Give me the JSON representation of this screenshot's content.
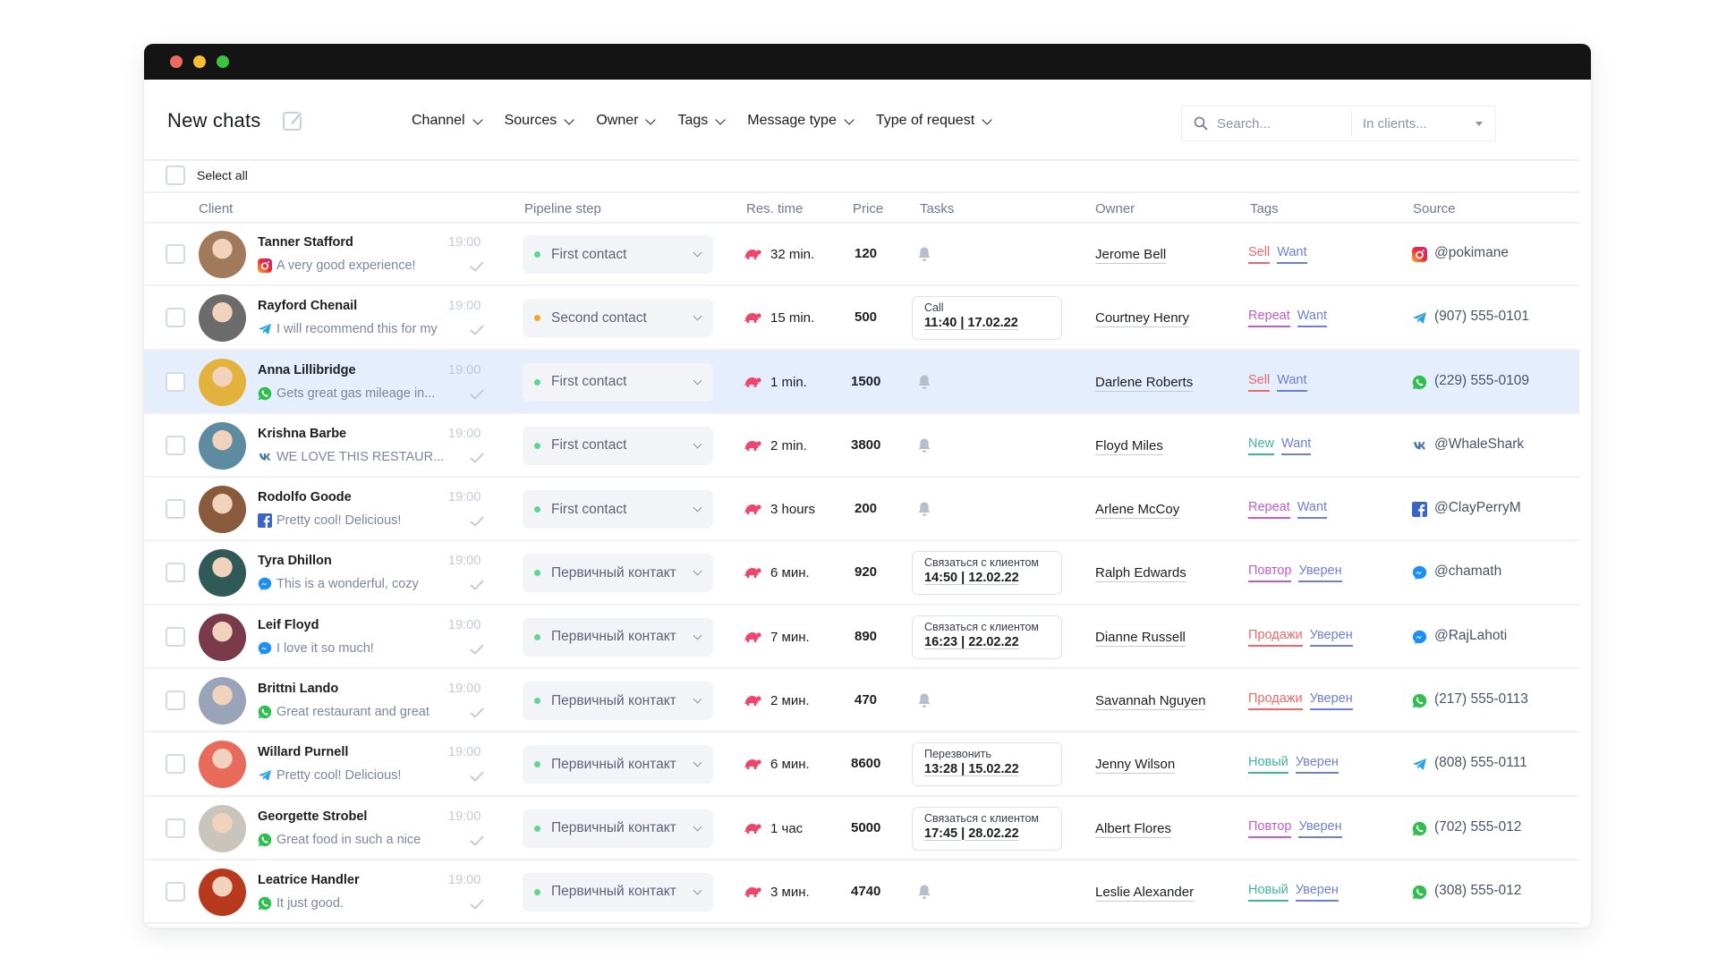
{
  "window": {
    "title_bar_buttons": [
      "close",
      "minimize",
      "maximize"
    ]
  },
  "header": {
    "title": "New chats",
    "edit_icon": "edit-icon",
    "filters": [
      {
        "label": "Channel"
      },
      {
        "label": "Sources"
      },
      {
        "label": "Owner"
      },
      {
        "label": "Tags"
      },
      {
        "label": "Message type"
      },
      {
        "label": "Type of request"
      }
    ],
    "search": {
      "placeholder": "Search...",
      "value": ""
    },
    "scope": {
      "placeholder": "In clients..."
    }
  },
  "select_all_label": "Select all",
  "columns": {
    "client": "Client",
    "pipeline": "Pipeline step",
    "res_time": "Res. time",
    "price": "Price",
    "tasks": "Tasks",
    "owner": "Owner",
    "tags": "Tags",
    "source": "Source"
  },
  "colors": {
    "accent_selected_row": "#e5eefc",
    "status_green": "#5dd68e",
    "status_orange": "#f5a623",
    "tag_red": "#e8696b",
    "tag_purple": "#c05ccb",
    "tag_blue": "#6f7fd4",
    "tag_teal": "#3fb59c",
    "turtle": "#f0456a"
  },
  "rows": [
    {
      "name": "Tanner Stafford",
      "time": "19:00",
      "channel": "instagram",
      "message": "A very good experience!",
      "pipeline": "First contact",
      "pipeline_status": "green",
      "res_time": "32 min.",
      "price": "120",
      "task": null,
      "owner": "Jerome Bell",
      "tags": [
        {
          "label": "Sell",
          "color": "red"
        },
        {
          "label": "Want",
          "color": "blue"
        }
      ],
      "source_channel": "instagram",
      "source": "@pokimane",
      "selected": false,
      "avatar_color": "#a07a5a"
    },
    {
      "name": "Rayford Chenail",
      "time": "19:00",
      "channel": "telegram",
      "message": "I will recommend this for my",
      "pipeline": "Second contact",
      "pipeline_status": "orange",
      "res_time": "15 min.",
      "price": "500",
      "task": {
        "title": "Call",
        "when": "11:40 | 17.02.22"
      },
      "owner": "Courtney Henry",
      "tags": [
        {
          "label": "Repeat",
          "color": "purple"
        },
        {
          "label": "Want",
          "color": "blue"
        }
      ],
      "source_channel": "telegram",
      "source": "(907) 555-0101",
      "selected": false,
      "avatar_color": "#6b6b6b"
    },
    {
      "name": "Anna Lillibridge",
      "time": "19:00",
      "channel": "whatsapp",
      "message": "Gets great gas mileage in...",
      "pipeline": "First contact",
      "pipeline_status": "green",
      "res_time": "1 min.",
      "price": "1500",
      "task": null,
      "owner": "Darlene Roberts",
      "tags": [
        {
          "label": "Sell",
          "color": "red"
        },
        {
          "label": "Want",
          "color": "blue"
        }
      ],
      "source_channel": "whatsapp",
      "source": "(229) 555-0109",
      "selected": true,
      "avatar_color": "#e3b23c"
    },
    {
      "name": "Krishna Barbe",
      "time": "19:00",
      "channel": "vk",
      "message": "WE LOVE THIS RESTAUR...",
      "pipeline": "First contact",
      "pipeline_status": "green",
      "res_time": "2 min.",
      "price": "3800",
      "task": null,
      "owner": "Floyd Miles",
      "tags": [
        {
          "label": "New",
          "color": "teal"
        },
        {
          "label": "Want",
          "color": "blue"
        }
      ],
      "source_channel": "vk",
      "source": "@WhaleShark",
      "selected": false,
      "avatar_color": "#5d8ca0"
    },
    {
      "name": "Rodolfo Goode",
      "time": "19:00",
      "channel": "facebook",
      "message": "Pretty cool! Delicious!",
      "pipeline": "First contact",
      "pipeline_status": "green",
      "res_time": "3 hours",
      "price": "200",
      "task": null,
      "owner": "Arlene McCoy",
      "tags": [
        {
          "label": "Repeat",
          "color": "purple"
        },
        {
          "label": "Want",
          "color": "blue"
        }
      ],
      "source_channel": "facebook",
      "source": "@ClayPerryM",
      "selected": false,
      "avatar_color": "#8a5a3c"
    },
    {
      "name": "Tyra Dhillon",
      "time": "19:00",
      "channel": "messenger",
      "message": "This is a wonderful, cozy",
      "pipeline": "Первичный контакт",
      "pipeline_status": "green",
      "res_time": "6 мин.",
      "price": "920",
      "task": {
        "title": "Связаться с клиентом",
        "when": "14:50 | 12.02.22"
      },
      "owner": "Ralph Edwards",
      "tags": [
        {
          "label": "Повтор",
          "color": "purple"
        },
        {
          "label": "Уверен",
          "color": "blue"
        }
      ],
      "source_channel": "messenger",
      "source": "@chamath",
      "selected": false,
      "avatar_color": "#2f5a58"
    },
    {
      "name": "Leif Floyd",
      "time": "19:00",
      "channel": "messenger",
      "message": "I love it so much!",
      "pipeline": "Первичный контакт",
      "pipeline_status": "green",
      "res_time": "7 мин.",
      "price": "890",
      "task": {
        "title": "Связаться с клиентом",
        "when": "16:23 | 22.02.22"
      },
      "owner": "Dianne Russell",
      "tags": [
        {
          "label": "Продажи",
          "color": "red"
        },
        {
          "label": "Уверен",
          "color": "blue"
        }
      ],
      "source_channel": "messenger",
      "source": "@RajLahoti",
      "selected": false,
      "avatar_color": "#7a3a4a"
    },
    {
      "name": "Brittni Lando",
      "time": "19:00",
      "channel": "whatsapp",
      "message": "Great restaurant and great",
      "pipeline": "Первичный контакт",
      "pipeline_status": "green",
      "res_time": "2 мин.",
      "price": "470",
      "task": null,
      "owner": "Savannah Nguyen",
      "tags": [
        {
          "label": "Продажи",
          "color": "red"
        },
        {
          "label": "Уверен",
          "color": "blue"
        }
      ],
      "source_channel": "whatsapp",
      "source": "(217) 555-0113",
      "selected": false,
      "avatar_color": "#9aa4b8"
    },
    {
      "name": "Willard Purnell",
      "time": "19:00",
      "channel": "telegram",
      "message": "Pretty cool! Delicious!",
      "pipeline": "Первичный контакт",
      "pipeline_status": "green",
      "res_time": "6 мин.",
      "price": "8600",
      "task": {
        "title": "Перезвонить",
        "when": "13:28 | 15.02.22"
      },
      "owner": "Jenny Wilson",
      "tags": [
        {
          "label": "Новый",
          "color": "teal"
        },
        {
          "label": "Уверен",
          "color": "blue"
        }
      ],
      "source_channel": "telegram",
      "source": "(808) 555-0111",
      "selected": false,
      "avatar_color": "#e86a5a"
    },
    {
      "name": "Georgette Strobel",
      "time": "19:00",
      "channel": "whatsapp",
      "message": "Great food in such a nice",
      "pipeline": "Первичный контакт",
      "pipeline_status": "green",
      "res_time": "1 час",
      "price": "5000",
      "task": {
        "title": "Связаться с клиентом",
        "when": "17:45 | 28.02.22"
      },
      "owner": "Albert Flores",
      "tags": [
        {
          "label": "Повтор",
          "color": "purple"
        },
        {
          "label": "Уверен",
          "color": "blue"
        }
      ],
      "source_channel": "whatsapp",
      "source": "(702) 555-012",
      "selected": false,
      "avatar_color": "#c9c4bc"
    },
    {
      "name": "Leatrice Handler",
      "time": "19:00",
      "channel": "whatsapp",
      "message": "It just good.",
      "pipeline": "Первичный контакт",
      "pipeline_status": "green",
      "res_time": "3 мин.",
      "price": "4740",
      "task": null,
      "owner": "Leslie Alexander",
      "tags": [
        {
          "label": "Новый",
          "color": "teal"
        },
        {
          "label": "Уверен",
          "color": "blue"
        }
      ],
      "source_channel": "whatsapp",
      "source": "(308) 555-012",
      "selected": false,
      "avatar_color": "#b83a1e"
    }
  ]
}
